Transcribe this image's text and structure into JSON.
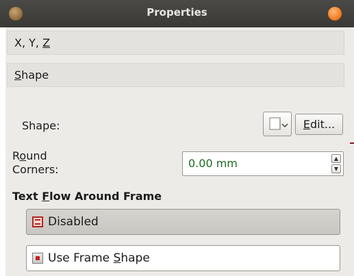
{
  "window": {
    "title": "Properties"
  },
  "sections": {
    "xyz": {
      "label_pre": "X, Y, ",
      "label_ul": "Z",
      "label_post": ""
    },
    "shape": {
      "label_pre": "",
      "label_ul": "S",
      "label_post": "hape"
    }
  },
  "shape_row": {
    "label": "Shape:",
    "edit_pre": "",
    "edit_ul": "E",
    "edit_post": "dit..."
  },
  "round_corners": {
    "line1_pre": "R",
    "line1_ul": "o",
    "line1_post": "und",
    "line2": "Corners:",
    "value": "0.00 mm"
  },
  "text_flow": {
    "title_pre": "Text ",
    "title_ul": "F",
    "title_post": "low Around Frame",
    "options": [
      {
        "pre": "Disabled",
        "ul": "",
        "post": ""
      },
      {
        "pre": "Use Frame ",
        "ul": "S",
        "post": "hape"
      }
    ]
  },
  "colors": {
    "accent_orange": "#f07b1f",
    "value_green": "#1f6b22",
    "icon_red": "#b3271f"
  }
}
